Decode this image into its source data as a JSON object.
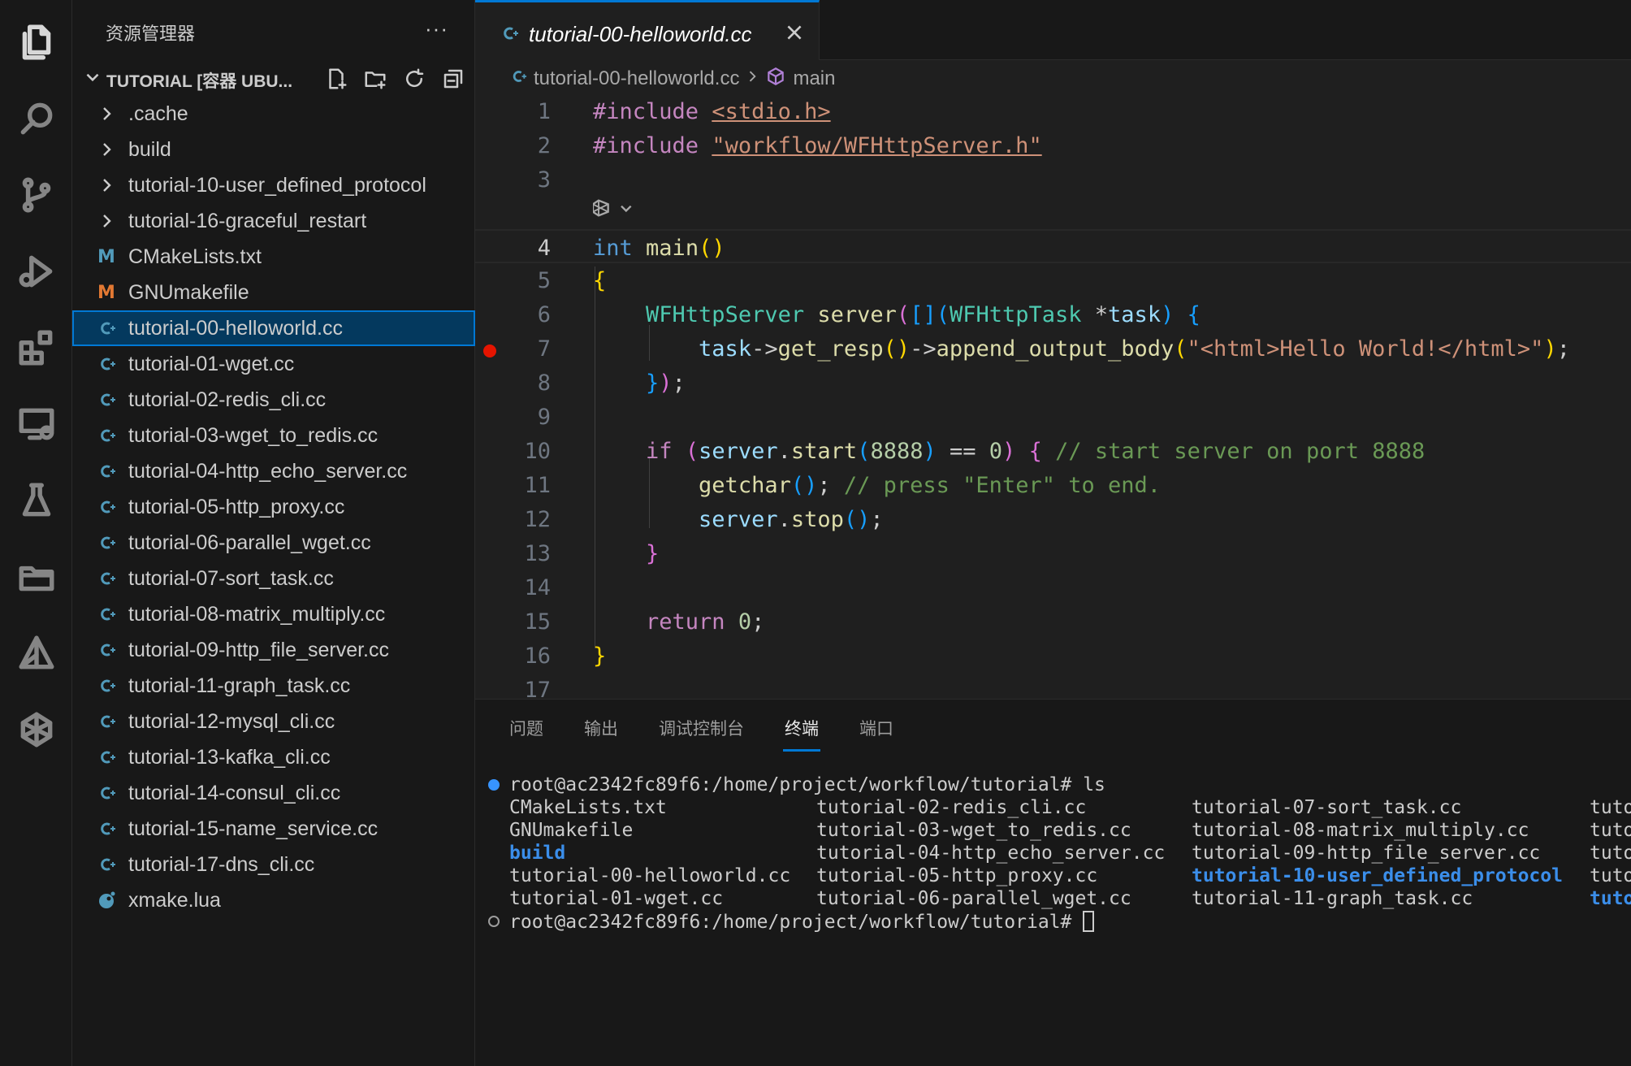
{
  "colors": {
    "accent": "#0078d4",
    "cpp_icon": "#519aba",
    "cmake_icon": "#519aba",
    "make_icon": "#e37933",
    "lua_icon": "#519aba",
    "breakpoint": "#e51400"
  },
  "sidebar": {
    "title": "资源管理器",
    "more": "···",
    "section": "TUTORIAL [容器 UBU...",
    "items": [
      {
        "label": ".cache",
        "kind": "folder"
      },
      {
        "label": "build",
        "kind": "folder"
      },
      {
        "label": "tutorial-10-user_defined_protocol",
        "kind": "folder"
      },
      {
        "label": "tutorial-16-graceful_restart",
        "kind": "folder"
      },
      {
        "label": "CMakeLists.txt",
        "kind": "cmake",
        "glyph": "M"
      },
      {
        "label": "GNUmakefile",
        "kind": "make",
        "glyph": "M"
      },
      {
        "label": "tutorial-00-helloworld.cc",
        "kind": "cpp",
        "selected": true
      },
      {
        "label": "tutorial-01-wget.cc",
        "kind": "cpp"
      },
      {
        "label": "tutorial-02-redis_cli.cc",
        "kind": "cpp"
      },
      {
        "label": "tutorial-03-wget_to_redis.cc",
        "kind": "cpp"
      },
      {
        "label": "tutorial-04-http_echo_server.cc",
        "kind": "cpp"
      },
      {
        "label": "tutorial-05-http_proxy.cc",
        "kind": "cpp"
      },
      {
        "label": "tutorial-06-parallel_wget.cc",
        "kind": "cpp"
      },
      {
        "label": "tutorial-07-sort_task.cc",
        "kind": "cpp"
      },
      {
        "label": "tutorial-08-matrix_multiply.cc",
        "kind": "cpp"
      },
      {
        "label": "tutorial-09-http_file_server.cc",
        "kind": "cpp"
      },
      {
        "label": "tutorial-11-graph_task.cc",
        "kind": "cpp"
      },
      {
        "label": "tutorial-12-mysql_cli.cc",
        "kind": "cpp"
      },
      {
        "label": "tutorial-13-kafka_cli.cc",
        "kind": "cpp"
      },
      {
        "label": "tutorial-14-consul_cli.cc",
        "kind": "cpp"
      },
      {
        "label": "tutorial-15-name_service.cc",
        "kind": "cpp"
      },
      {
        "label": "tutorial-17-dns_cli.cc",
        "kind": "cpp"
      },
      {
        "label": "xmake.lua",
        "kind": "lua"
      }
    ]
  },
  "editor": {
    "tab_title": "tutorial-00-helloworld.cc",
    "breadcrumb_file": "tutorial-00-helloworld.cc",
    "breadcrumb_symbol": "main",
    "line_numbers": [
      "1",
      "2",
      "3",
      "4",
      "5",
      "6",
      "7",
      "8",
      "9",
      "10",
      "11",
      "12",
      "13",
      "14",
      "15",
      "16",
      "17"
    ],
    "code": {
      "l1": [
        "#include ",
        "<stdio.h>"
      ],
      "l2": [
        "#include ",
        "\"workflow/WFHttpServer.h\""
      ],
      "l4": [
        "int",
        " ",
        "main",
        "()"
      ],
      "l5": [
        "{"
      ],
      "l6": [
        "    ",
        "WFHttpServer",
        " ",
        "server",
        "(",
        "[]",
        "(",
        "WFHttpTask",
        " *",
        "task",
        ")",
        " {"
      ],
      "l7": [
        "        ",
        "task",
        "->",
        "get_resp",
        "()",
        "->",
        "append_output_body",
        "(",
        "\"<html>Hello World!</html>\"",
        ")",
        ";"
      ],
      "l8": [
        "    ",
        "}",
        ")",
        ";"
      ],
      "l10": [
        "    ",
        "if",
        " ",
        "(",
        "server",
        ".",
        "start",
        "(",
        "8888",
        ")",
        " == ",
        "0",
        ")",
        " ",
        "{",
        " ",
        "// start server on port 8888"
      ],
      "l11": [
        "        ",
        "getchar",
        "()",
        "; ",
        "// press \"Enter\" to end."
      ],
      "l12": [
        "        ",
        "server",
        ".",
        "stop",
        "()",
        ";"
      ],
      "l13": [
        "    ",
        "}"
      ],
      "l15": [
        "    ",
        "return",
        " ",
        "0",
        ";"
      ],
      "l16": [
        "}"
      ]
    }
  },
  "panel": {
    "tabs": [
      "问题",
      "输出",
      "调试控制台",
      "终端",
      "端口"
    ],
    "active_tab": "终端",
    "prompt1": "root@ac2342fc89f6:/home/project/workflow/tutorial# ls",
    "prompt2": "root@ac2342fc89f6:/home/project/workflow/tutorial# ",
    "ls_columns": [
      [
        "CMakeLists.txt",
        "GNUmakefile",
        "build",
        "tutorial-00-helloworld.cc",
        "tutorial-01-wget.cc"
      ],
      [
        "tutorial-02-redis_cli.cc",
        "tutorial-03-wget_to_redis.cc",
        "tutorial-04-http_echo_server.cc",
        "tutorial-05-http_proxy.cc",
        "tutorial-06-parallel_wget.cc"
      ],
      [
        "tutorial-07-sort_task.cc",
        "tutorial-08-matrix_multiply.cc",
        "tutorial-09-http_file_server.cc",
        "tutorial-10-user_defined_protocol",
        "tutorial-11-graph_task.cc"
      ],
      [
        "tuto",
        "tuto",
        "tuto",
        "tuto",
        "tuto"
      ]
    ]
  }
}
